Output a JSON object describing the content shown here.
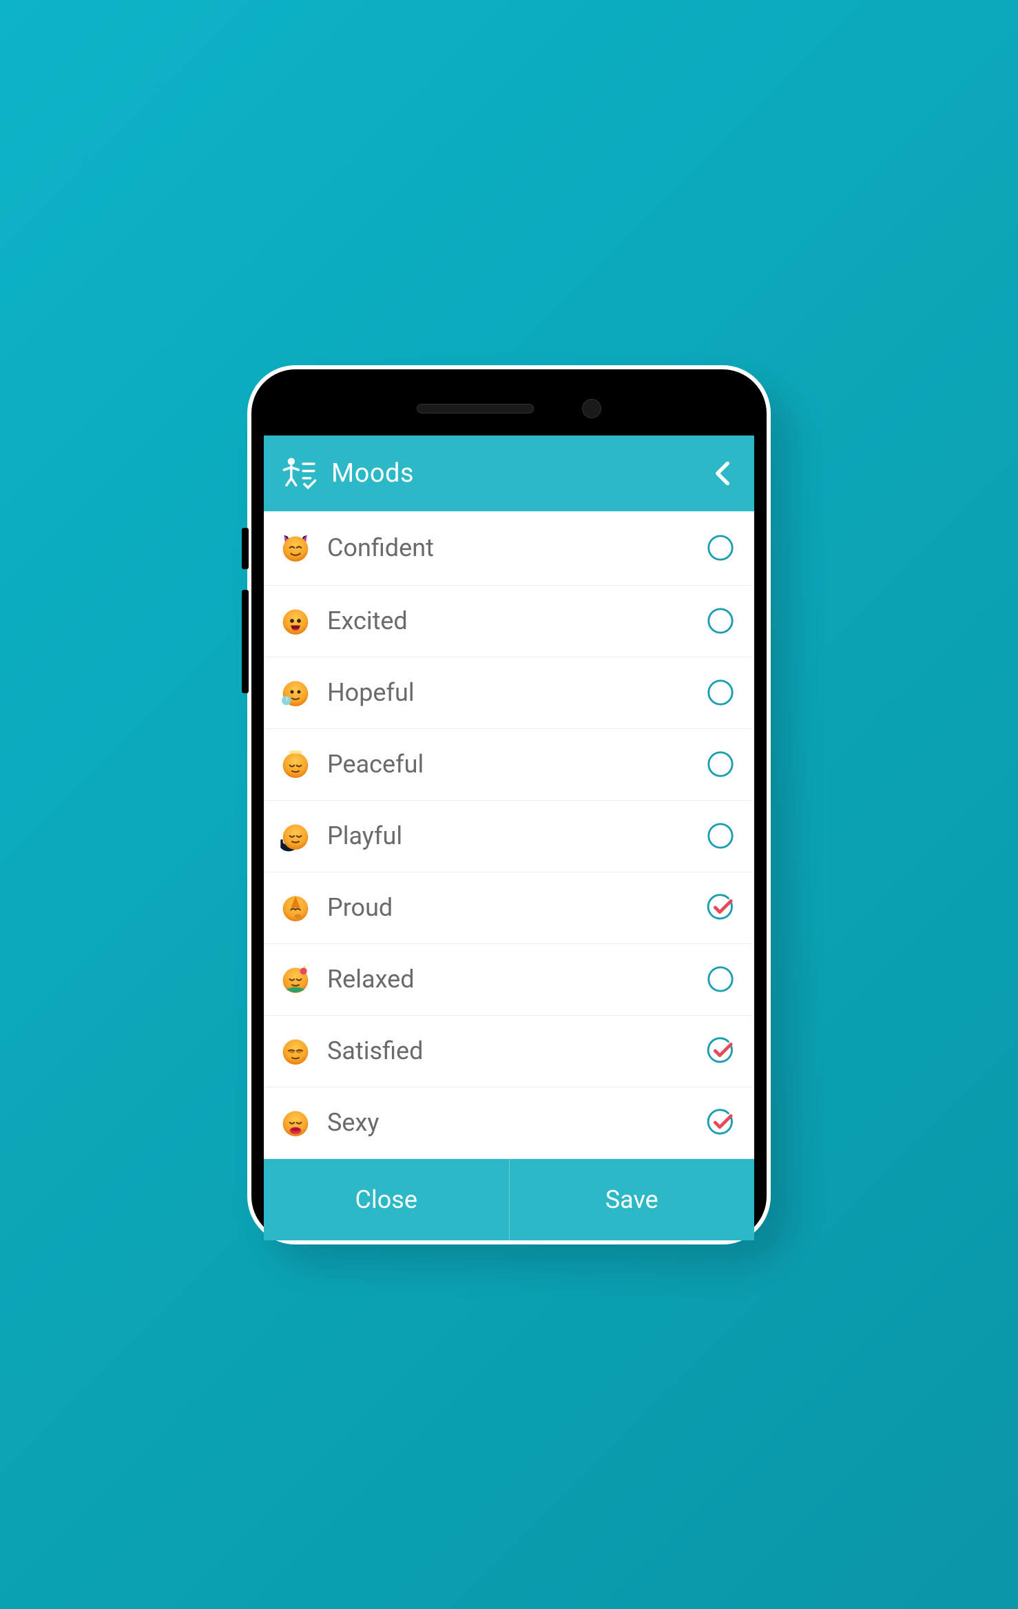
{
  "header": {
    "title": "Moods"
  },
  "moods": [
    {
      "label": "Confident",
      "icon": "confident",
      "checked": false
    },
    {
      "label": "Excited",
      "icon": "excited",
      "checked": false
    },
    {
      "label": "Hopeful",
      "icon": "hopeful",
      "checked": false
    },
    {
      "label": "Peaceful",
      "icon": "peaceful",
      "checked": false
    },
    {
      "label": "Playful",
      "icon": "playful",
      "checked": false
    },
    {
      "label": "Proud",
      "icon": "proud",
      "checked": true
    },
    {
      "label": "Relaxed",
      "icon": "relaxed",
      "checked": false
    },
    {
      "label": "Satisfied",
      "icon": "satisfied",
      "checked": true
    },
    {
      "label": "Sexy",
      "icon": "sexy",
      "checked": true
    }
  ],
  "footer": {
    "close_label": "Close",
    "save_label": "Save"
  },
  "colors": {
    "brand": "#2db8c7",
    "ring": "#1a9eb0",
    "check": "#e44a5a",
    "text": "#6a6a6a"
  }
}
